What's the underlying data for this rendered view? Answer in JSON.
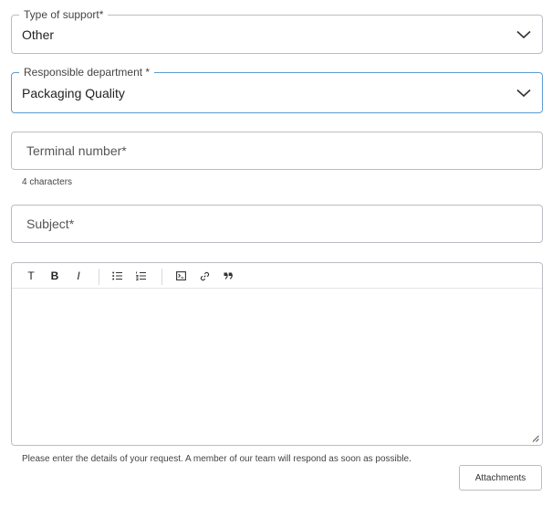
{
  "support_type": {
    "label": "Type of support",
    "required_mark": "*",
    "value": "Other"
  },
  "department": {
    "label": "Responsible department",
    "required_mark": "*",
    "value": "Packaging Quality"
  },
  "terminal": {
    "placeholder": "Terminal number",
    "required_mark": "*",
    "helper": "4 characters"
  },
  "subject": {
    "placeholder": "Subject",
    "required_mark": "*"
  },
  "editor": {
    "toolbar": {
      "text_label": "T",
      "bold_label": "B",
      "italic_label": "I",
      "icons": [
        "text-style-icon",
        "bold-icon",
        "italic-icon",
        "bullet-list-icon",
        "numbered-list-icon",
        "code-block-icon",
        "link-icon",
        "quote-icon"
      ]
    },
    "helper": "Please enter the details of your request. A member of our team will respond as soon as possible."
  },
  "attachments_button": {
    "label": "Attachments"
  },
  "colors": {
    "border": "#b9bdc2",
    "focus_border": "#5b9bd1",
    "text": "#222222"
  }
}
